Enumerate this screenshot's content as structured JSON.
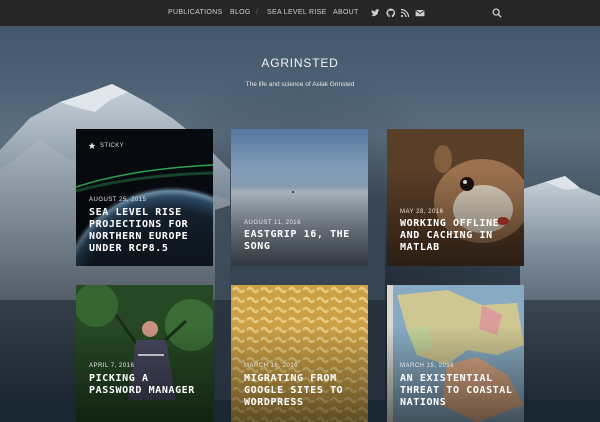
{
  "nav": {
    "items": [
      "PUBLICATIONS",
      "BLOG",
      "SEA LEVEL RISE",
      "ABOUT"
    ],
    "separator": "/",
    "social_icons": [
      "twitter-icon",
      "github-icon",
      "rss-icon",
      "email-icon"
    ],
    "search_icon": "search-icon"
  },
  "site": {
    "title": "AGRINSTED",
    "tagline": "The life and science of Aslak Grinsted"
  },
  "posts": [
    {
      "sticky_label": "STICKY",
      "date": "AUGUST 25, 2015",
      "title": "SEA LEVEL RISE PROJECTIONS FOR NORTHERN EUROPE UNDER RCP8.5"
    },
    {
      "date": "AUGUST 11, 2016",
      "title": "EASTGRIP 16, THE SONG"
    },
    {
      "date": "MAY 28, 2016",
      "title": "WORKING OFFLINE AND CACHING IN MATLAB"
    },
    {
      "date": "APRIL 7, 2016",
      "title": "PICKING A PASSWORD MANAGER"
    },
    {
      "date": "MARCH 16, 2016",
      "title": "MIGRATING FROM GOOGLE SITES TO WORDPRESS"
    },
    {
      "date": "MARCH 15, 2016",
      "title": "AN EXISTENTIAL THREAT TO COASTAL NATIONS"
    }
  ],
  "colors": {
    "topbar": "#262626",
    "nav_text": "#cfcfcf",
    "card_title": "#ffffff"
  }
}
